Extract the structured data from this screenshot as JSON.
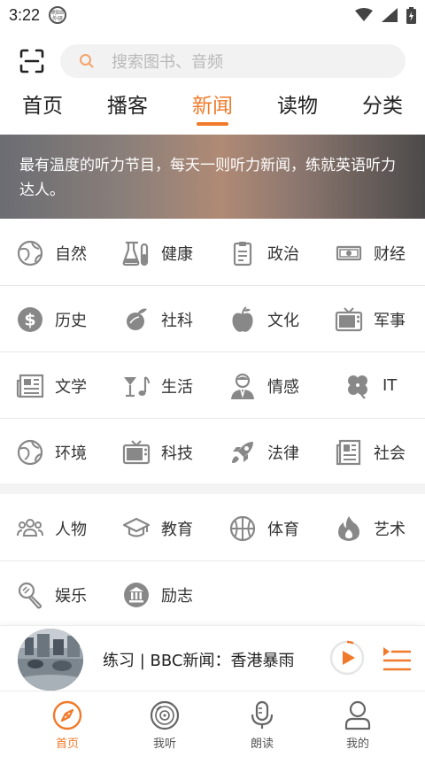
{
  "status_bar": {
    "time": "3:22",
    "app_badge": "刷BB 外研"
  },
  "search": {
    "placeholder": "搜索图书、音频"
  },
  "tabs": [
    {
      "label": "首页"
    },
    {
      "label": "播客"
    },
    {
      "label": "新闻"
    },
    {
      "label": "读物"
    },
    {
      "label": "分类"
    }
  ],
  "active_tab": "新闻",
  "banner": {
    "text": "最有温度的听力节目，每天一则听力新闻，练就英语听力达人。"
  },
  "categories": [
    {
      "label": "自然",
      "icon": "globe-icon"
    },
    {
      "label": "健康",
      "icon": "flask-icon"
    },
    {
      "label": "政治",
      "icon": "clipboard-icon"
    },
    {
      "label": "财经",
      "icon": "money-icon"
    },
    {
      "label": "历史",
      "icon": "dollar-icon"
    },
    {
      "label": "社科",
      "icon": "leaf-icon"
    },
    {
      "label": "文化",
      "icon": "apple-icon"
    },
    {
      "label": "军事",
      "icon": "tv-icon"
    },
    {
      "label": "文学",
      "icon": "newspaper-icon"
    },
    {
      "label": "生活",
      "icon": "cocktail-music-icon"
    },
    {
      "label": "情感",
      "icon": "person-icon"
    },
    {
      "label": "IT",
      "icon": "clover-icon"
    },
    {
      "label": "环境",
      "icon": "globe-icon"
    },
    {
      "label": "科技",
      "icon": "tv-icon"
    },
    {
      "label": "法律",
      "icon": "rocket-icon"
    },
    {
      "label": "社会",
      "icon": "document-icon"
    },
    {
      "label": "人物",
      "icon": "people-icon"
    },
    {
      "label": "教育",
      "icon": "graduation-cap-icon"
    },
    {
      "label": "体育",
      "icon": "basketball-icon"
    },
    {
      "label": "艺术",
      "icon": "fire-icon"
    },
    {
      "label": "娱乐",
      "icon": "microphone-icon"
    },
    {
      "label": "励志",
      "icon": "bank-icon"
    }
  ],
  "player": {
    "title": "练习 | BBC新闻：香港暴雨"
  },
  "bottom_nav": [
    {
      "label": "首页",
      "icon": "compass-icon"
    },
    {
      "label": "我听",
      "icon": "vinyl-icon"
    },
    {
      "label": "朗读",
      "icon": "microphone-icon"
    },
    {
      "label": "我的",
      "icon": "user-icon"
    }
  ],
  "colors": {
    "accent": "#f07a2a",
    "icon_gray": "#888888",
    "text": "#222222"
  }
}
